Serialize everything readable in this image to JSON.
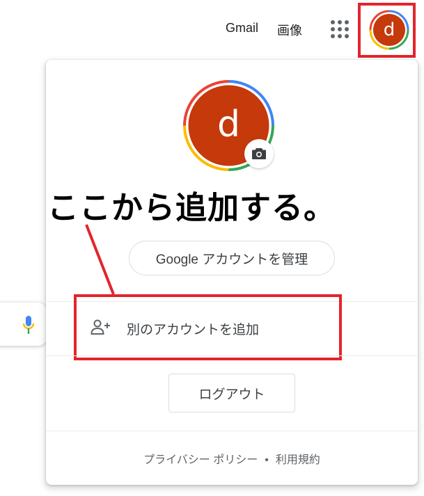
{
  "header": {
    "gmail_label": "Gmail",
    "images_label": "画像",
    "apps_icon": "apps-grid-icon",
    "avatar_initial": "d"
  },
  "account_panel": {
    "avatar_initial": "d",
    "camera_icon": "camera-icon",
    "manage_account_label": "Google アカウントを管理",
    "add_account_label": "別のアカウントを追加",
    "add_account_icon": "add-person-icon",
    "logout_label": "ログアウト",
    "privacy_policy_label": "プライバシー ポリシー",
    "footer_separator": "•",
    "terms_label": "利用規約"
  },
  "annotation": {
    "callout_text": "ここから追加する。",
    "highlight_color": "#e3242b"
  },
  "search": {
    "mic_icon": "microphone-icon"
  },
  "colors": {
    "avatar_bg": "#c5390b",
    "google_blue": "#4285f4",
    "google_red": "#ea4335",
    "google_yellow": "#fbbc04",
    "google_green": "#34a853"
  }
}
